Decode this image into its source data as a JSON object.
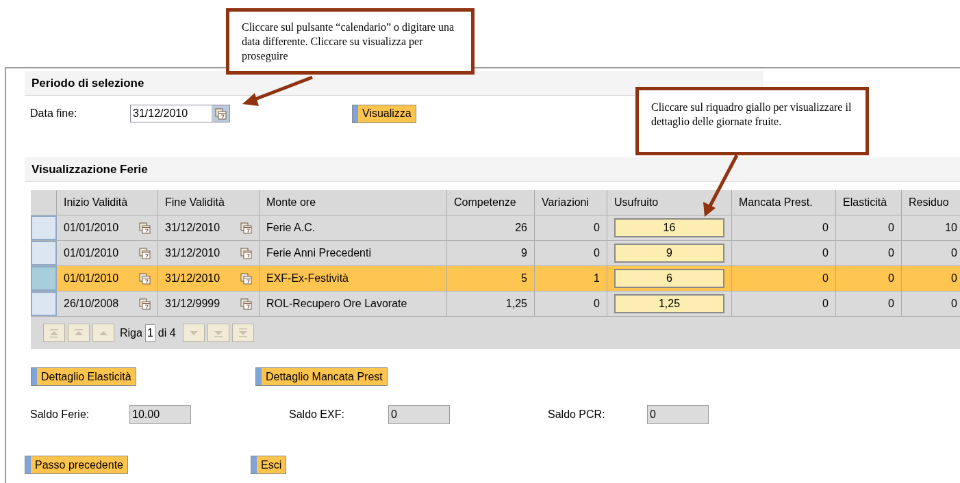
{
  "callouts": [
    {
      "text": "Cliccare sul pulsante “calendario” o digitare una data differente. Cliccare su visualizza per proseguire"
    },
    {
      "text": "Cliccare sul riquadro giallo per visualizzare il dettaglio delle giornate fruite."
    }
  ],
  "selection_period": {
    "title": "Periodo di selezione",
    "date_label": "Data fine:",
    "date_value": "31/12/2010",
    "show_button": "Visualizza"
  },
  "vacation": {
    "title": "Visualizzazione Ferie",
    "columns": [
      "Inizio Validità",
      "Fine Validità",
      "Monte ore",
      "Competenze",
      "Variazioni",
      "Usufruito",
      "Mancata Prest.",
      "Elasticità",
      "Residuo"
    ],
    "rows": [
      {
        "selected": false,
        "cells": [
          "01/01/2010",
          "31/12/2010",
          "Ferie A.C.",
          "26",
          "0",
          "16",
          "0",
          "0",
          "10"
        ]
      },
      {
        "selected": false,
        "cells": [
          "01/01/2010",
          "31/12/2010",
          "Ferie Anni Precedenti",
          "9",
          "0",
          "9",
          "0",
          "0",
          "0"
        ]
      },
      {
        "selected": true,
        "cells": [
          "01/01/2010",
          "31/12/2010",
          "EXF-Ex-Festività",
          "5",
          "1",
          "6",
          "0",
          "0",
          "0"
        ]
      },
      {
        "selected": false,
        "cells": [
          "26/10/2008",
          "31/12/9999",
          "ROL-Recupero Ore Lavorate",
          "1,25",
          "0",
          "1,25",
          "0",
          "0",
          "0"
        ]
      }
    ],
    "pager": {
      "prefix": "Riga",
      "value": "1",
      "suffix": "di 4"
    }
  },
  "detail_buttons": [
    "Dettaglio Elasticità",
    "Dettaglio Mancata Prest"
  ],
  "balances": [
    {
      "label": "Saldo Ferie:",
      "value": "10.00"
    },
    {
      "label": "Saldo EXF:",
      "value": "0"
    },
    {
      "label": "Saldo PCR:",
      "value": "0"
    }
  ],
  "footer_buttons": [
    "Passo precedente",
    "Esci"
  ]
}
